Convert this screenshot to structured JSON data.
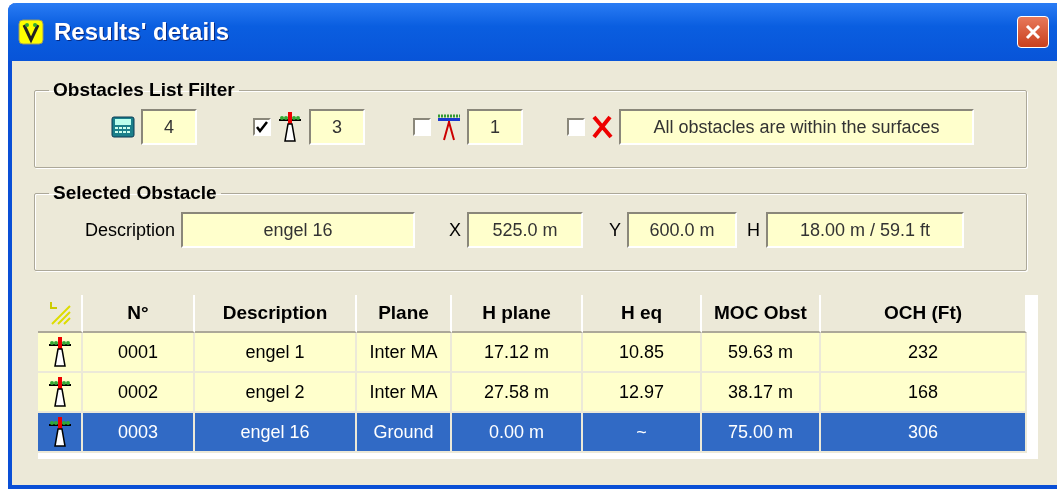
{
  "window": {
    "title": "Results' details"
  },
  "filter": {
    "title": "Obstacles List Filter",
    "items": [
      {
        "kind": "total",
        "value": "4"
      },
      {
        "kind": "obstacle",
        "checked": true,
        "value": "3"
      },
      {
        "kind": "ground",
        "checked": false,
        "value": "1"
      },
      {
        "kind": "outside",
        "checked": false,
        "value": "All obstacles are within the surfaces"
      }
    ]
  },
  "selected_obstacle": {
    "title": "Selected Obstacle",
    "fields": [
      {
        "label": "Description",
        "value": "engel 16"
      },
      {
        "label": "X",
        "value": "525.0 m"
      },
      {
        "label": "Y",
        "value": "600.0 m"
      },
      {
        "label": "H",
        "value": "18.00 m / 59.1 ft"
      }
    ]
  },
  "table": {
    "columns": [
      "N°",
      "Description",
      "Plane",
      "H plane",
      "H eq",
      "MOC Obst",
      "OCH (Ft)"
    ],
    "rows": [
      {
        "selected": false,
        "cells": [
          "0001",
          "engel 1",
          "Inter MA",
          "17.12 m",
          "10.85",
          "59.63 m",
          "232"
        ]
      },
      {
        "selected": false,
        "cells": [
          "0002",
          "engel 2",
          "Inter MA",
          "27.58 m",
          "12.97",
          "38.17 m",
          "168"
        ]
      },
      {
        "selected": true,
        "cells": [
          "0003",
          "engel 16",
          "Ground",
          "0.00 m",
          "~",
          "75.00 m",
          "306"
        ]
      }
    ]
  }
}
